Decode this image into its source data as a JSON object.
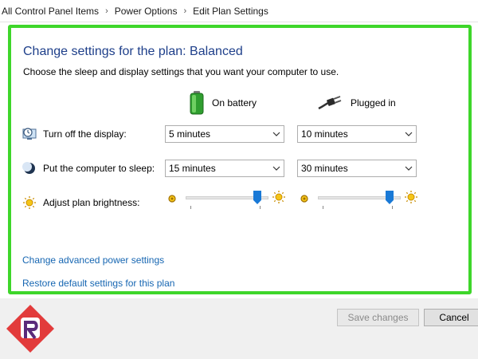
{
  "breadcrumb": [
    "All Control Panel Items",
    "Power Options",
    "Edit Plan Settings"
  ],
  "plan": {
    "title": "Change settings for the plan: Balanced",
    "subtitle": "Choose the sleep and display settings that you want your computer to use."
  },
  "columns": {
    "battery": "On battery",
    "plugged": "Plugged in"
  },
  "rows": {
    "display": {
      "label": "Turn off the display:",
      "battery": "5 minutes",
      "plugged": "10 minutes"
    },
    "sleep": {
      "label": "Put the computer to sleep:",
      "battery": "15 minutes",
      "plugged": "30 minutes"
    },
    "brightness": {
      "label": "Adjust plan brightness:",
      "battery_level": 0.9,
      "plugged_level": 0.9
    }
  },
  "links": {
    "advanced": "Change advanced power settings",
    "restore": "Restore default settings for this plan"
  },
  "buttons": {
    "save": "Save changes",
    "cancel": "Cancel"
  },
  "colors": {
    "highlight": "#3ed62a",
    "title": "#1e3f8a",
    "link": "#1666b2",
    "slider_thumb": "#1979d6",
    "logo_red": "#e23b3b"
  },
  "icons": {
    "display": "monitor-clock-icon",
    "sleep": "moon-icon",
    "brightness": "sun-icon",
    "battery": "battery-icon",
    "plugged": "power-plug-icon"
  }
}
